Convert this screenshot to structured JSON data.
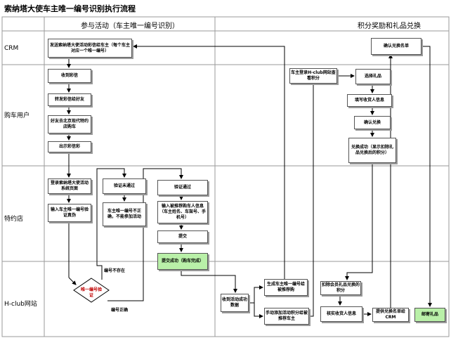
{
  "title": "索纳塔大使车主唯一编号识别执行流程",
  "columns": {
    "left": "参与活动（车主唯一编号识别）",
    "right": "积分奖励和礼品兑换"
  },
  "lanes": {
    "crm": "CRM",
    "buyer": "购车用户",
    "dealer": "特约店",
    "hclub": "H-club网站"
  },
  "boxes": {
    "send_sms": "发送索纳塔大使活动彩信给车主（每个车主对应一个唯一编号）",
    "confirm_list": "确认兑换名单",
    "receive_sms": "收到彩信",
    "forward_sms": "转发彩信给好友",
    "friend_visit": "好友去北京现代特约店购车",
    "show_sms": "出示彩信彩",
    "login_system": "登录索纳塔大使活动系统页面",
    "enter_number": "输入车主唯一编号验证真伪",
    "verify_fail": "验证未通过",
    "wrong_number": "车主唯一编号不正确，不能参加活动",
    "verify_pass": "验证通过",
    "enter_info": "输入被推荐购车人信息（车主姓名、车架号、手机号）",
    "submit": "提交",
    "submit_ok": "提交成功（购车完成）",
    "hclub_login": "车主登录H-club网站查看积分",
    "choose_gift": "选择礼品",
    "fill_info": "填写收货人信息",
    "confirm_exchange": "确认兑换",
    "exchange_ok": "兑换成功（显示扣除礼品兑换后的积分）",
    "receive_data": "收到活动成功数据",
    "gen_number": "生成车主唯一编号给被推荐购",
    "manual_points": "手动添加活动积分给被推荐车主",
    "deduct_points": "扣除会员礼品兑换的积分",
    "verify_receiver": "核实收货人信息",
    "provide_list": "提供兑换名单给CRM",
    "mail_gift": "邮寄礼品"
  },
  "decision": {
    "label": "唯一编号验证",
    "no_label": "编号不存在",
    "yes_label": "编号正确"
  }
}
